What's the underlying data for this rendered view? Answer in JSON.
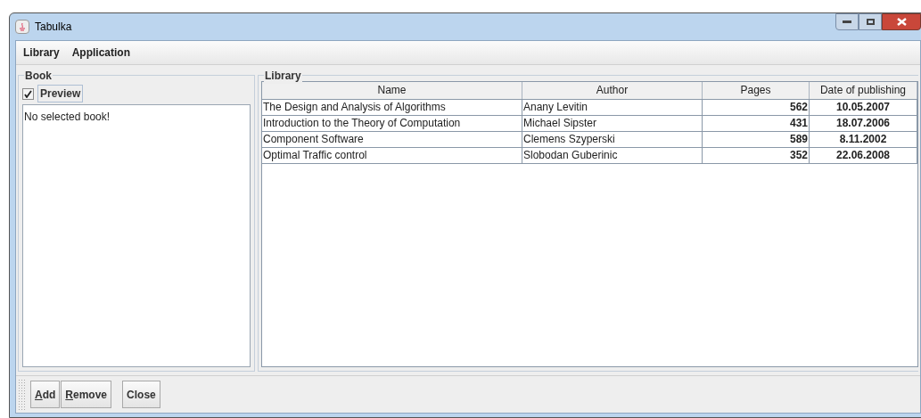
{
  "window": {
    "title": "Tabulka"
  },
  "menu": [
    "Library",
    "Application"
  ],
  "book_panel": {
    "title": "Book",
    "preview": {
      "label": "Preview",
      "checked": true
    },
    "text": "No selected book!"
  },
  "library_panel": {
    "title": "Library",
    "table": {
      "columns": [
        "Name",
        "Author",
        "Pages",
        "Date of publishing"
      ],
      "rows": [
        [
          "The Design and Analysis of Algorithms",
          "Anany Levitin",
          "562",
          "10.05.2007"
        ],
        [
          "Introduction to the Theory of Computation",
          "Michael Sipster",
          "431",
          "18.07.2006"
        ],
        [
          "Component Software",
          "Clemens Szyperski",
          "589",
          "8.11.2002"
        ],
        [
          "Optimal Traffic control",
          "Slobodan Guberinic",
          "352",
          "22.06.2008"
        ]
      ]
    }
  },
  "toolbar_groups": [
    [
      {
        "label": "Add",
        "underline_first": true
      },
      {
        "label": "Remove",
        "underline_first": true
      }
    ],
    [
      {
        "label": "Close",
        "underline_first": false
      }
    ]
  ]
}
